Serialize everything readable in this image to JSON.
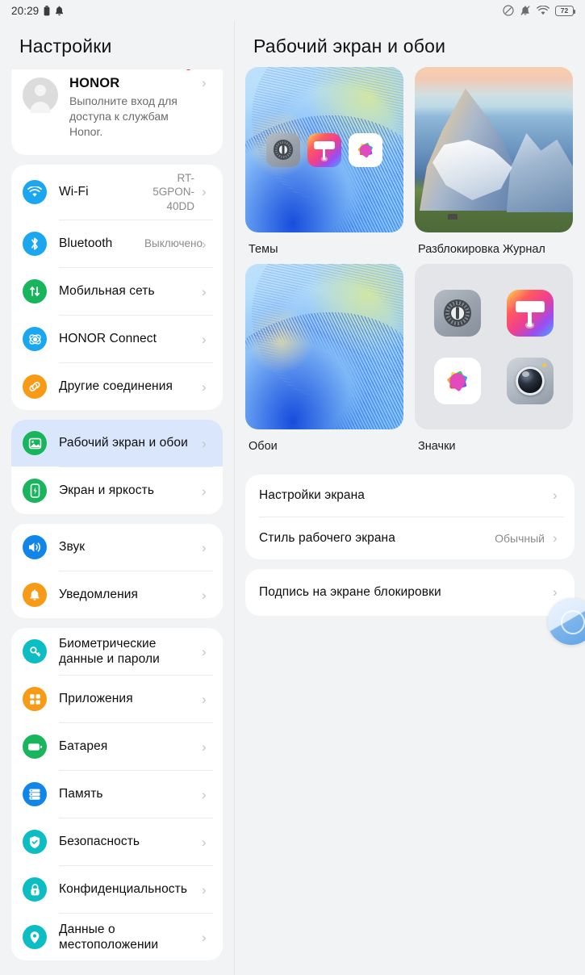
{
  "statusbar": {
    "time": "20:29",
    "left_icons": [
      "battery-small-icon",
      "bell-icon"
    ],
    "right_icons": [
      "do-not-disturb-icon",
      "bell-muted-icon",
      "wifi-icon"
    ],
    "battery_percent": "72"
  },
  "sidebar": {
    "title": "Настройки",
    "account": {
      "name": "HONOR",
      "subtitle": "Выполните вход для доступа к службам Honor.",
      "has_badge": true
    },
    "groups": [
      {
        "items": [
          {
            "label": "Wi-Fi",
            "value": "RT-5GPON-40DD",
            "icon": "wifi-icon",
            "color": "#1ba7f0",
            "selected": false
          },
          {
            "label": "Bluetooth",
            "value": "Выключено",
            "icon": "bluetooth-icon",
            "color": "#1ba7f0",
            "selected": false
          },
          {
            "label": "Мобильная сеть",
            "value": "",
            "icon": "mobile-network-icon",
            "color": "#18b55c",
            "selected": false
          },
          {
            "label": "HONOR Connect",
            "value": "",
            "icon": "honor-connect-icon",
            "color": "#1ba7f0",
            "selected": false
          },
          {
            "label": "Другие соединения",
            "value": "",
            "icon": "link-icon",
            "color": "#f79a16",
            "selected": false
          }
        ]
      },
      {
        "items": [
          {
            "label": "Рабочий экран и обои",
            "value": "",
            "icon": "wallpaper-icon",
            "color": "#18b55c",
            "selected": true
          },
          {
            "label": "Экран и яркость",
            "value": "",
            "icon": "display-brightness-icon",
            "color": "#18b55c",
            "selected": false
          }
        ]
      },
      {
        "items": [
          {
            "label": "Звук",
            "value": "",
            "icon": "sound-icon",
            "color": "#1186e8",
            "selected": false
          },
          {
            "label": "Уведомления",
            "value": "",
            "icon": "notification-bell-icon",
            "color": "#f79a16",
            "selected": false
          }
        ]
      },
      {
        "items": [
          {
            "label": "Биометрические данные и пароли",
            "value": "",
            "icon": "key-icon",
            "color": "#0dbdc4",
            "selected": false
          },
          {
            "label": "Приложения",
            "value": "",
            "icon": "apps-grid-icon",
            "color": "#f79a16",
            "selected": false
          },
          {
            "label": "Батарея",
            "value": "",
            "icon": "battery-icon",
            "color": "#18b55c",
            "selected": false
          },
          {
            "label": "Память",
            "value": "",
            "icon": "storage-icon",
            "color": "#1186e8",
            "selected": false
          },
          {
            "label": "Безопасность",
            "value": "",
            "icon": "shield-check-icon",
            "color": "#0dbdc4",
            "selected": false
          },
          {
            "label": "Конфиденциальность",
            "value": "",
            "icon": "lock-icon",
            "color": "#0dbdc4",
            "selected": false
          },
          {
            "label": "Данные о местоположении",
            "value": "",
            "icon": "location-pin-icon",
            "color": "#0dbdc4",
            "selected": false
          }
        ]
      }
    ]
  },
  "main": {
    "title": "Рабочий экран и обои",
    "tiles": [
      {
        "label": "Темы",
        "art": "themes"
      },
      {
        "label": "Разблокировка Журнал",
        "art": "mountain"
      },
      {
        "label": "Обои",
        "art": "wallpaper"
      },
      {
        "label": "Значки",
        "art": "icons"
      }
    ],
    "list_groups": [
      {
        "rows": [
          {
            "label": "Настройки экрана",
            "value": ""
          },
          {
            "label": "Стиль рабочего экрана",
            "value": "Обычный"
          }
        ]
      },
      {
        "rows": [
          {
            "label": "Подпись на экране блокировки",
            "value": ""
          }
        ]
      }
    ]
  },
  "colors": {
    "background": "#f1f3f5",
    "card": "#ffffff",
    "selected_row": "#dae6fb",
    "accent": "#1ba7f0",
    "badge": "#e8321e"
  }
}
